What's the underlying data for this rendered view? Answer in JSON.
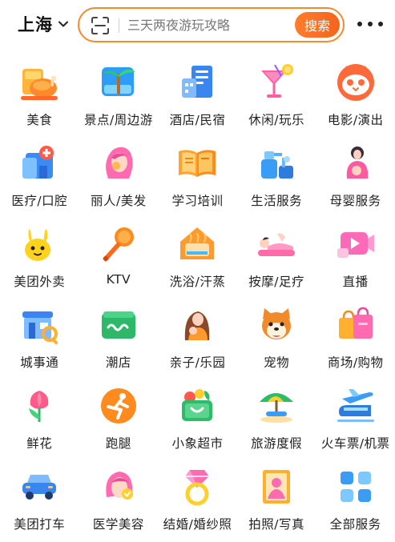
{
  "header": {
    "city": "上海",
    "search_placeholder": "三天两夜游玩攻略",
    "search_button": "搜索"
  },
  "categories": [
    {
      "label": "美食",
      "icon": "roast-chicken-icon"
    },
    {
      "label": "景点/周边游",
      "icon": "palm-tree-icon"
    },
    {
      "label": "酒店/民宿",
      "icon": "hotel-building-icon"
    },
    {
      "label": "休闲/玩乐",
      "icon": "cocktail-icon"
    },
    {
      "label": "电影/演出",
      "icon": "cat-face-icon"
    },
    {
      "label": "医疗/口腔",
      "icon": "medical-kit-icon"
    },
    {
      "label": "丽人/美发",
      "icon": "woman-hair-icon"
    },
    {
      "label": "学习培训",
      "icon": "open-book-icon"
    },
    {
      "label": "生活服务",
      "icon": "spray-bottle-icon"
    },
    {
      "label": "母婴服务",
      "icon": "mother-baby-icon"
    },
    {
      "label": "美团外卖",
      "icon": "kangaroo-icon"
    },
    {
      "label": "KTV",
      "icon": "microphone-icon"
    },
    {
      "label": "洗浴/汗蒸",
      "icon": "bathhouse-icon"
    },
    {
      "label": "按摩/足疗",
      "icon": "massage-icon"
    },
    {
      "label": "直播",
      "icon": "live-video-icon"
    },
    {
      "label": "城事通",
      "icon": "city-storefront-icon"
    },
    {
      "label": "潮店",
      "icon": "chao-store-icon"
    },
    {
      "label": "亲子/乐园",
      "icon": "parent-child-icon"
    },
    {
      "label": "宠物",
      "icon": "shiba-dog-icon"
    },
    {
      "label": "商场/购物",
      "icon": "shopping-bag-icon"
    },
    {
      "label": "鲜花",
      "icon": "tulip-flower-icon"
    },
    {
      "label": "跑腿",
      "icon": "runner-icon"
    },
    {
      "label": "小象超市",
      "icon": "grocery-basket-icon"
    },
    {
      "label": "旅游度假",
      "icon": "beach-umbrella-icon"
    },
    {
      "label": "火车票/机票",
      "icon": "train-plane-icon"
    },
    {
      "label": "美团打车",
      "icon": "taxi-car-icon"
    },
    {
      "label": "医学美容",
      "icon": "beauty-face-icon"
    },
    {
      "label": "结婚/婚纱照",
      "icon": "diamond-ring-icon"
    },
    {
      "label": "拍照/写真",
      "icon": "photo-frame-icon"
    },
    {
      "label": "全部服务",
      "icon": "all-services-icon"
    }
  ]
}
